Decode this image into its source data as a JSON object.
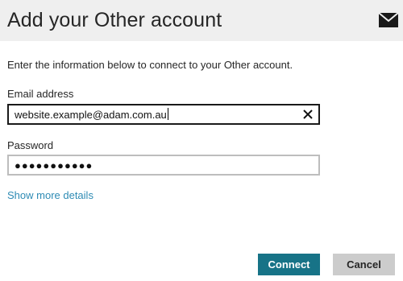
{
  "dialog": {
    "title": "Add your Other account",
    "header_icon": "mail-envelope-icon",
    "intro": "Enter the information below to connect to your Other account."
  },
  "email": {
    "label": "Email address",
    "value": "website.example@adam.com.au",
    "clear_icon": "close-x-icon"
  },
  "password": {
    "label": "Password",
    "masked_value": "●●●●●●●●●●●"
  },
  "links": {
    "show_more": "Show more details"
  },
  "buttons": {
    "connect": "Connect",
    "cancel": "Cancel"
  },
  "colors": {
    "header_bg": "#efefef",
    "accent": "#177387",
    "link": "#2e8bb4",
    "cancel_bg": "#cccccc"
  }
}
